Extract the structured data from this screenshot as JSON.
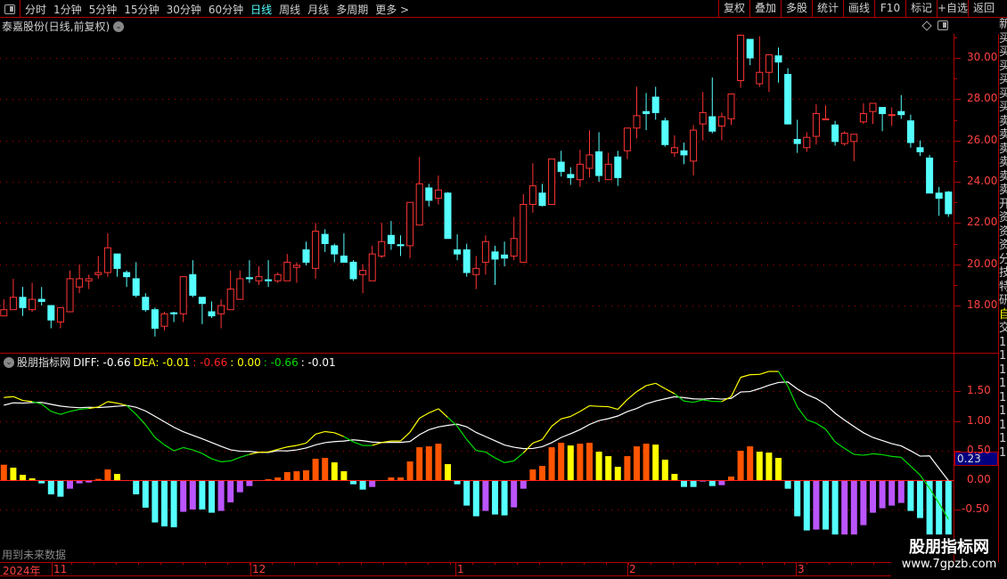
{
  "menu": {
    "periods": [
      "分时",
      "1分钟",
      "5分钟",
      "15分钟",
      "30分钟",
      "60分钟",
      "日线",
      "周线",
      "月线",
      "多周期",
      "更多 >"
    ],
    "active": "日线",
    "buttons": [
      "复权",
      "叠加",
      "多股",
      "统计",
      "画线",
      "F10",
      "标记",
      "+自选",
      "返回"
    ]
  },
  "title": "泰嘉股份(日线,前复权)",
  "macd_header": {
    "name": "股朋指标网",
    "diff": "DIFF: -0.66",
    "dea": "DEA: -0.01",
    "v1": ": -0.66",
    "v2": ": 0.00",
    "v3": ": -0.66",
    "v4": ": -0.01"
  },
  "future_note": "用到未来数据",
  "cursor_value": "0.23",
  "price_axis": [
    "30.00",
    "28.00",
    "26.00",
    "24.00",
    "22.00",
    "20.00",
    "18.00"
  ],
  "macd_axis": [
    "1.50",
    "1.00",
    "0.50",
    "0.00",
    "-0.50"
  ],
  "time_axis": [
    "2024年",
    "11",
    "12",
    "1",
    "2",
    "3"
  ],
  "right_column": [
    "新",
    "买",
    "买",
    "买",
    "买",
    "买",
    "买",
    "卖",
    "卖",
    "卖",
    "卖",
    "卖",
    "卖",
    "开",
    "资",
    "资",
    "资",
    "分",
    "技",
    "特",
    "研",
    "自",
    "交",
    "1",
    "1",
    "1",
    "1",
    "1",
    "1",
    "1",
    "1",
    "1"
  ],
  "watermark": {
    "line1": "股朋指标网",
    "line2": "www.7gpzb.com"
  },
  "colors": {
    "up": "#ff3333",
    "down": "#55ffff",
    "grid": "#b00000",
    "diff_above": "#ffff00",
    "diff_below": "#00dd00",
    "dea": "#ffffff",
    "hist_up_rise": "#ff5500",
    "hist_up_fall": "#ffff00",
    "hist_dn_fall": "#55ffff",
    "hist_dn_rise": "#bb55ff"
  },
  "chart_data": {
    "type": "candlestick+macd",
    "price_ylim": [
      16,
      31.5
    ],
    "macd_ylim": [
      -1,
      2
    ],
    "candles_ohlc": [
      [
        17.5,
        18.3,
        17.5,
        17.8
      ],
      [
        17.8,
        19.3,
        17.8,
        18.4
      ],
      [
        18.4,
        18.9,
        17.5,
        17.9
      ],
      [
        17.8,
        19.1,
        17.7,
        18.3
      ],
      [
        18.3,
        18.9,
        18.0,
        18.2
      ],
      [
        18.0,
        18.0,
        16.9,
        17.3
      ],
      [
        17.2,
        17.9,
        16.9,
        17.9
      ],
      [
        17.7,
        19.7,
        17.7,
        19.3
      ],
      [
        18.9,
        20.0,
        18.6,
        19.3
      ],
      [
        19.2,
        19.5,
        18.8,
        19.3
      ],
      [
        19.5,
        20.4,
        19.3,
        19.6
      ],
      [
        19.6,
        21.5,
        19.4,
        20.8
      ],
      [
        20.5,
        20.5,
        19.4,
        19.8
      ],
      [
        19.6,
        19.7,
        18.9,
        19.4
      ],
      [
        19.3,
        20.1,
        18.4,
        18.5
      ],
      [
        18.4,
        18.6,
        17.7,
        17.8
      ],
      [
        17.8,
        17.9,
        16.5,
        16.9
      ],
      [
        17.0,
        17.7,
        16.8,
        17.6
      ],
      [
        17.65,
        17.7,
        17.2,
        17.6
      ],
      [
        17.6,
        19.4,
        17.2,
        19.4
      ],
      [
        19.5,
        20.2,
        18.4,
        18.5
      ],
      [
        18.4,
        18.4,
        17.1,
        18.1
      ],
      [
        17.7,
        18.2,
        17.4,
        17.5
      ],
      [
        17.6,
        18.3,
        16.9,
        18.0
      ],
      [
        17.8,
        19.7,
        17.8,
        18.8
      ],
      [
        18.3,
        19.7,
        18.3,
        19.3
      ],
      [
        19.35,
        20.2,
        19.1,
        19.3
      ],
      [
        19.2,
        19.9,
        19.0,
        19.4
      ],
      [
        19.25,
        20.2,
        18.9,
        19.2
      ],
      [
        19.2,
        19.6,
        19.1,
        19.5
      ],
      [
        19.2,
        20.5,
        19.2,
        20.1
      ],
      [
        19.85,
        20.1,
        19.1,
        19.95
      ],
      [
        20.7,
        21.1,
        19.95,
        20.1
      ],
      [
        19.8,
        22.0,
        19.3,
        21.6
      ],
      [
        21.45,
        21.7,
        20.6,
        21.0
      ],
      [
        20.9,
        21.0,
        20.1,
        20.5
      ],
      [
        20.4,
        21.5,
        20.1,
        20.1
      ],
      [
        20.1,
        20.2,
        19.2,
        19.3
      ],
      [
        19.5,
        20.0,
        18.6,
        19.7
      ],
      [
        19.2,
        20.9,
        19.2,
        20.5
      ],
      [
        20.4,
        22.0,
        20.3,
        21.1
      ],
      [
        21.4,
        22.1,
        20.7,
        21.0
      ],
      [
        20.95,
        21.4,
        20.4,
        20.9
      ],
      [
        20.9,
        23.0,
        20.3,
        23.0
      ],
      [
        21.9,
        25.2,
        21.9,
        23.9
      ],
      [
        23.7,
        23.9,
        22.8,
        23.1
      ],
      [
        23.2,
        24.3,
        22.9,
        23.6
      ],
      [
        23.45,
        23.5,
        21.25,
        21.25
      ],
      [
        20.7,
        21.45,
        20.2,
        20.5
      ],
      [
        20.7,
        21.0,
        19.4,
        19.6
      ],
      [
        19.5,
        20.4,
        18.8,
        19.8
      ],
      [
        20.1,
        21.4,
        19.5,
        21.1
      ],
      [
        20.6,
        20.9,
        19.0,
        20.25
      ],
      [
        20.45,
        21.1,
        19.9,
        20.3
      ],
      [
        20.4,
        22.3,
        20.2,
        21.25
      ],
      [
        20.1,
        23.4,
        20.1,
        22.9
      ],
      [
        22.9,
        24.9,
        22.5,
        23.8
      ],
      [
        23.45,
        23.9,
        22.8,
        22.85
      ],
      [
        22.9,
        25.1,
        22.9,
        25.1
      ],
      [
        24.95,
        25.5,
        24.25,
        24.5
      ],
      [
        24.35,
        24.7,
        23.85,
        24.2
      ],
      [
        24.1,
        25.55,
        23.75,
        24.85
      ],
      [
        24.65,
        26.5,
        24.2,
        25.3
      ],
      [
        25.45,
        26.4,
        24.0,
        24.3
      ],
      [
        24.1,
        25.4,
        24.1,
        24.85
      ],
      [
        25.2,
        25.5,
        23.8,
        24.2
      ],
      [
        25.5,
        26.6,
        25.1,
        26.6
      ],
      [
        26.6,
        28.6,
        26.1,
        27.2
      ],
      [
        27.4,
        28.3,
        26.5,
        27.3
      ],
      [
        28.1,
        28.6,
        27.0,
        27.35
      ],
      [
        26.95,
        27.1,
        25.7,
        25.8
      ],
      [
        25.4,
        26.25,
        25.2,
        25.65
      ],
      [
        25.5,
        25.9,
        24.85,
        25.3
      ],
      [
        25.0,
        26.75,
        24.3,
        26.5
      ],
      [
        26.8,
        28.35,
        26.0,
        27.35
      ],
      [
        27.15,
        29.05,
        26.35,
        26.45
      ],
      [
        26.7,
        27.35,
        26.0,
        27.15
      ],
      [
        27.05,
        28.25,
        26.75,
        28.25
      ],
      [
        28.9,
        31.1,
        28.55,
        31.1
      ],
      [
        30.9,
        30.9,
        29.65,
        30.0
      ],
      [
        28.75,
        31.05,
        28.6,
        29.3
      ],
      [
        29.3,
        30.15,
        28.35,
        30.15
      ],
      [
        30.1,
        30.5,
        28.8,
        29.8
      ],
      [
        29.2,
        29.5,
        26.8,
        26.8
      ],
      [
        26.05,
        27.0,
        25.4,
        25.85
      ],
      [
        25.65,
        26.4,
        25.45,
        26.15
      ],
      [
        26.2,
        27.75,
        25.8,
        27.3
      ],
      [
        27.0,
        27.7,
        27.0,
        27.05
      ],
      [
        26.75,
        26.95,
        25.75,
        25.95
      ],
      [
        25.85,
        26.45,
        25.75,
        26.35
      ],
      [
        25.95,
        26.3,
        25.0,
        26.3
      ],
      [
        26.9,
        27.8,
        26.8,
        27.3
      ],
      [
        27.4,
        27.8,
        26.8,
        27.8
      ],
      [
        27.6,
        27.6,
        26.45,
        27.3
      ],
      [
        27.25,
        27.6,
        26.7,
        27.25
      ],
      [
        27.4,
        28.2,
        27.05,
        27.25
      ],
      [
        26.95,
        27.25,
        25.65,
        25.9
      ],
      [
        25.65,
        26.0,
        25.25,
        25.45
      ],
      [
        25.15,
        25.3,
        23.45,
        23.45
      ],
      [
        23.45,
        23.75,
        22.35,
        23.2
      ],
      [
        23.5,
        23.55,
        22.3,
        22.45
      ]
    ],
    "diff": [
      1.395,
      1.41,
      1.345,
      1.325,
      1.285,
      1.16,
      1.11,
      1.16,
      1.195,
      1.21,
      1.235,
      1.325,
      1.3,
      1.26,
      1.11,
      0.935,
      0.72,
      0.595,
      0.495,
      0.55,
      0.51,
      0.45,
      0.36,
      0.31,
      0.325,
      0.385,
      0.435,
      0.47,
      0.475,
      0.52,
      0.56,
      0.585,
      0.625,
      0.775,
      0.82,
      0.8,
      0.735,
      0.645,
      0.585,
      0.585,
      0.635,
      0.66,
      0.66,
      0.81,
      1.045,
      1.135,
      1.205,
      1.06,
      0.91,
      0.685,
      0.5,
      0.475,
      0.375,
      0.295,
      0.325,
      0.46,
      0.625,
      0.685,
      0.91,
      1.035,
      1.075,
      1.16,
      1.255,
      1.245,
      1.24,
      1.195,
      1.36,
      1.495,
      1.595,
      1.635,
      1.545,
      1.46,
      1.335,
      1.315,
      1.355,
      1.33,
      1.325,
      1.41,
      1.735,
      1.78,
      1.785,
      1.835,
      1.835,
      1.585,
      1.235,
      1.02,
      0.96,
      0.86,
      0.645,
      0.535,
      0.435,
      0.42,
      0.445,
      0.43,
      0.4,
      0.385,
      0.235,
      0.085,
      -0.14,
      -0.39,
      -0.66
    ],
    "macd": [
      0.26,
      0.21,
      0.09,
      0.03,
      -0.055,
      -0.24,
      -0.28,
      -0.145,
      -0.055,
      -0.04,
      0.02,
      0.18,
      0.105,
      0,
      -0.24,
      -0.465,
      -0.715,
      -0.78,
      -0.795,
      -0.535,
      -0.495,
      -0.495,
      -0.55,
      -0.52,
      -0.375,
      -0.205,
      -0.1,
      0,
      0.015,
      0.045,
      0.135,
      0.15,
      0.165,
      0.36,
      0.375,
      0.3,
      0.15,
      -0.07,
      -0.16,
      -0.115,
      0,
      0.045,
      0.045,
      0.315,
      0.555,
      0.57,
      0.615,
      0.27,
      -0.07,
      -0.43,
      -0.61,
      -0.52,
      -0.58,
      -0.595,
      -0.46,
      -0.145,
      0.18,
      0.24,
      0.555,
      0.63,
      0.585,
      0.615,
      0.63,
      0.48,
      0.405,
      0.225,
      0.405,
      0.57,
      0.615,
      0.6,
      0.345,
      0.105,
      -0.115,
      -0.115,
      -0.025,
      -0.1,
      -0.085,
      0.06,
      0.495,
      0.57,
      0.48,
      0.465,
      0.375,
      -0.145,
      -0.61,
      -0.85,
      -0.835,
      -0.835,
      -0.97,
      -0.955,
      -0.94,
      -0.76,
      -0.55,
      -0.475,
      -0.43,
      -0.385,
      -0.52,
      -0.64,
      -1.1,
      -1.18,
      -1.3
    ],
    "price_gridlines": [
      18,
      20,
      22,
      24,
      26,
      28,
      30
    ],
    "macd_gridlines": [
      1.5,
      1.0,
      0.5,
      -0.5
    ]
  }
}
